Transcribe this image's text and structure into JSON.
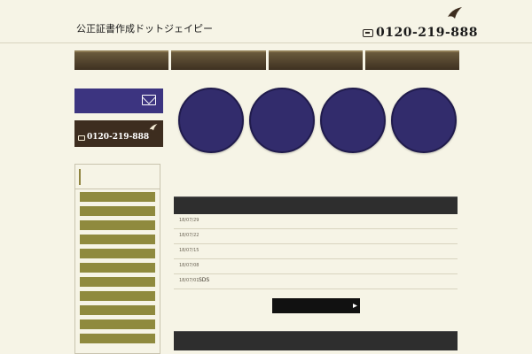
{
  "header": {
    "site_title": "公正証書作成ドットジェイピー",
    "phone": "0120-219-888"
  },
  "sidebar": {
    "phone": "0120-219-888"
  },
  "news": {
    "items": [
      {
        "date": "18/07/29"
      },
      {
        "date": "18/07/22"
      },
      {
        "date": "18/07/15"
      },
      {
        "date": "18/07/08"
      },
      {
        "date": "18/07/01",
        "text": "SDS"
      }
    ]
  },
  "colors": {
    "background": "#f6f4e6",
    "nav_brown": "#4a3b27",
    "circle_navy": "#322c6c",
    "side_olive": "#8f8a3e",
    "dark_bar": "#2e2e2e"
  }
}
